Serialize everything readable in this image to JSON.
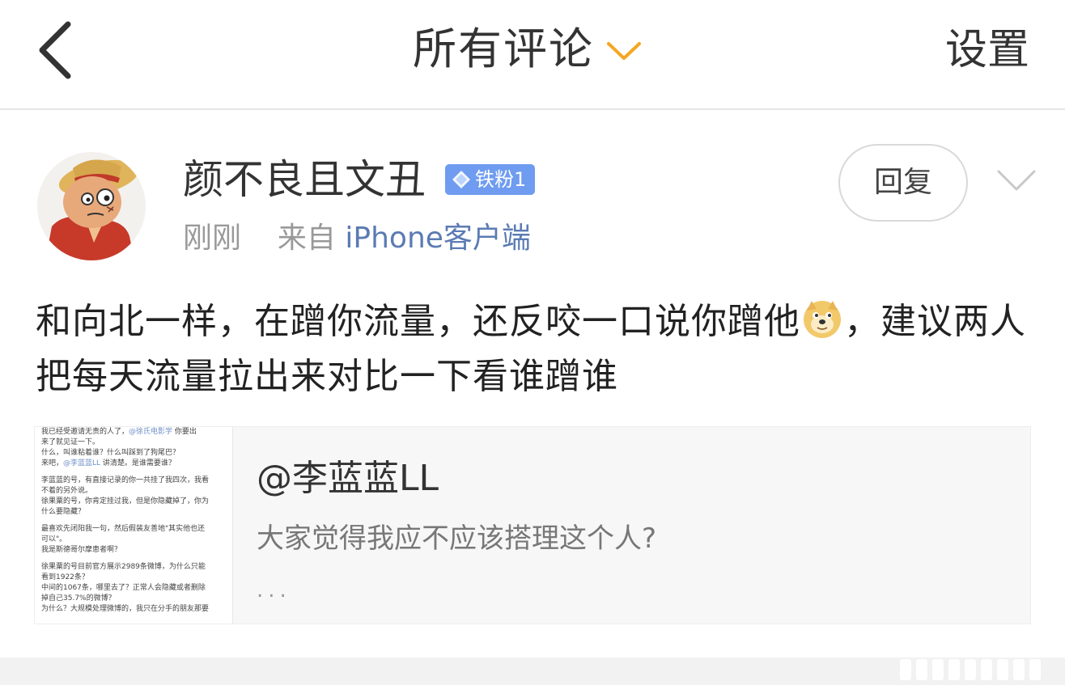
{
  "header": {
    "title": "所有评论",
    "settings_label": "设置",
    "accent_color": "#f5a623"
  },
  "comment": {
    "username": "颜不良且文丑",
    "fan_badge": "铁粉1",
    "time": "刚刚",
    "source_prefix": "来自",
    "source": "iPhone客户端",
    "reply_label": "回复",
    "text_part1": "和向北一样，在蹭你流量，还反咬一口说你蹭他",
    "emoji": "doge-emoji",
    "text_part2": "，建议两人把每天流量拉出来对比一下看谁蹭谁"
  },
  "quote": {
    "author": "@李蓝蓝LL",
    "text": "大家觉得我应不应该搭理这个人?",
    "ellipsis": "...",
    "thumbnail_lines": [
      "我已经受邀请无责的人了，@徐氏电影学 你要出",
      "来了就见证一下。",
      "什么，叫谁粘着谁？什么叫踩到了狗尾巴？",
      "来吧，@李蓝蓝LL 讲清楚。是谁需要谁？",
      "",
      "李蓝蓝的号，有直接记录的你一共挂了我四次，我看",
      "不着的另外说。",
      "徐果粟的号，你肯定挂过我，但是你隐藏掉了，你为",
      "什么要隐藏？",
      "",
      "最喜欢先闭阳我一句，然后假装友善地\"其实他也还",
      "可以\"。",
      "我是斯德哥尔摩患者啊？",
      "",
      "徐果粟的号目前官方展示2989条微博，为什么只能",
      "看到1922条？",
      "中间的1067条，哪里去了？正常人会隐藏或者删除",
      "掉自己35.7%的微博？",
      "为什么？大规模处理微博的，我只在分手的朋友那要"
    ]
  }
}
